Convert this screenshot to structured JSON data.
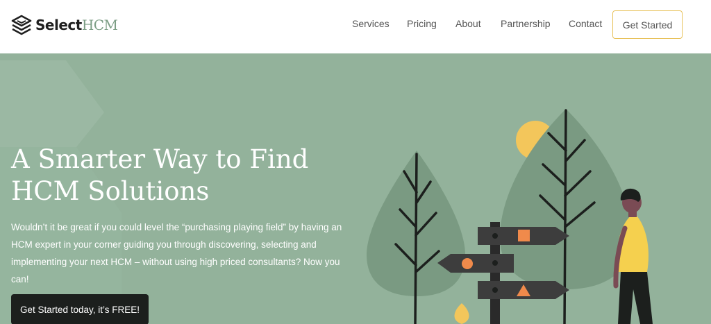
{
  "brand": {
    "name_bold": "Select",
    "name_light": "HCM"
  },
  "nav": {
    "items": [
      {
        "label": "Services"
      },
      {
        "label": "Pricing"
      },
      {
        "label": "About"
      },
      {
        "label": "Partnership"
      },
      {
        "label": "Contact"
      }
    ],
    "cta_label": "Get Started"
  },
  "hero": {
    "title_line1": "A Smarter Way to Find",
    "title_line2": "HCM Solutions",
    "description": "Wouldn’t it be great if you could level the “purchasing playing field” by having an HCM expert in your corner guiding you through discovering, selecting and implementing your next HCM – without using high priced consultants? Now you can!",
    "cta_label": "Get Started today, it’s FREE!"
  },
  "colors": {
    "hero_bg": "#93b29b",
    "accent_border": "#e8c25a",
    "sun": "#f3c65b",
    "sign_dark": "#3d3d3d",
    "sign_orange": "#f08a4b",
    "person_shirt": "#f5d04e",
    "brand_green": "#7c9e85"
  },
  "icons": {
    "logo": "stacked-layers-icon",
    "sign_shapes": [
      "square-icon",
      "circle-icon",
      "triangle-icon"
    ]
  }
}
